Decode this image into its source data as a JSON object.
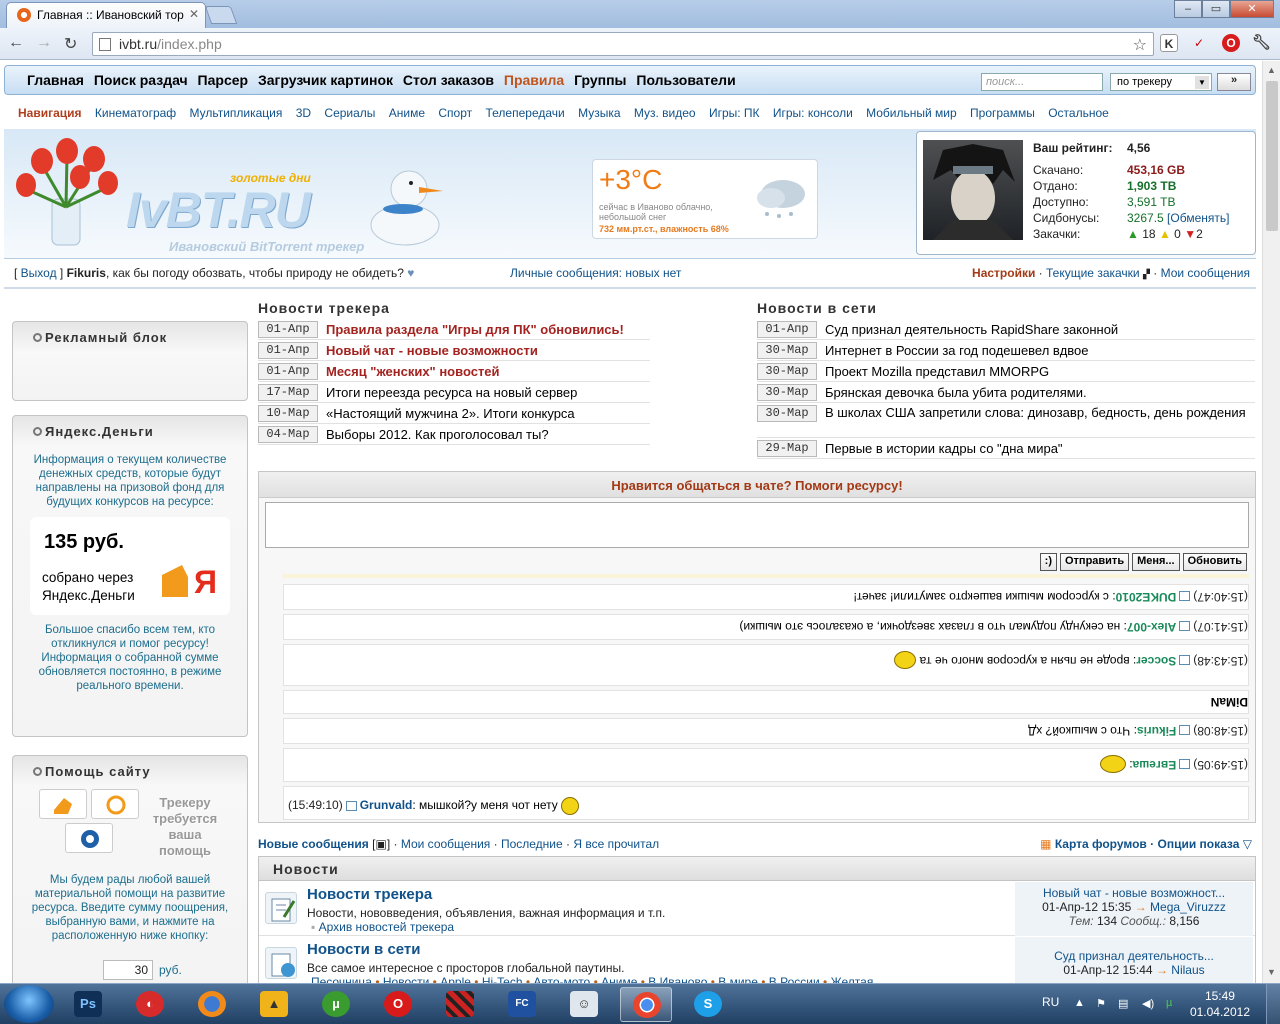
{
  "browser": {
    "tab_title": "Главная :: Ивановский тор",
    "url_host": "ivbt.ru",
    "url_path": "/index.php",
    "window_min": "–",
    "window_max": "▭",
    "window_close": "✕"
  },
  "site": {
    "menu": [
      "Главная",
      "Поиск раздач",
      "Парсер",
      "Загрузчик картинок",
      "Стол заказов",
      "Правила",
      "Группы",
      "Пользователи"
    ],
    "search_placeholder": "поиск...",
    "search_scope": "по трекеру",
    "search_go": "»",
    "categories": [
      "Навигация",
      "Кинематограф",
      "Мультипликация",
      "3D",
      "Сериалы",
      "Аниме",
      "Спорт",
      "Телепередачи",
      "Музыка",
      "Муз. видео",
      "Игры: ПК",
      "Игры: консоли",
      "Мобильный мир",
      "Программы",
      "Остальное"
    ],
    "logo_text": "IvBT.RU",
    "logo_tagline": "золотые дни",
    "logo_subtitle": "Ивановский BitTorrent трекер"
  },
  "weather": {
    "temp": "+3°C",
    "desc": "сейчас в Иваново облачно, небольшой снег",
    "pressure": "732 мм.рт.ст., влажность 68%"
  },
  "user": {
    "rating_label": "Ваш рейтинг:",
    "rating": "4,56",
    "downloaded_label": "Скачано:",
    "downloaded": "453,16 GB",
    "uploaded_label": "Отдано:",
    "uploaded": "1,903 TB",
    "available_label": "Доступно:",
    "available": "3,591 TB",
    "bonus_label": "Сидбонусы:",
    "bonus": "3267.5",
    "bonus_exchange": "[Обменять]",
    "torrents_label": "Закачки:",
    "seeding": "18",
    "leeching": "0",
    "stopped": "2",
    "logout": "Выход",
    "username": "Fikuris",
    "greeting": ", как бы погоду обозвать, чтобы природу не обидеть?",
    "pm_status": "Личные сообщения: новых нет",
    "settings": "Настройки",
    "current_downloads": "Текущие закачки",
    "my_messages": "Мои сообщения"
  },
  "sidebar": {
    "ad_title": "Рекламный блок",
    "yandex_title": "Яндекс.Деньги",
    "yandex_text": "Информация о текущем количестве денежных средств, которые будут направлены на призовой фонд для будущих конкурсов на ресурсе:",
    "yandex_sum": "135 руб.",
    "yandex_via": "собрано через Яндекс.Деньги",
    "yandex_thanks": "Большое спасибо всем тем, кто откликнулся и помог ресурсу! Информация о собранной сумме обновляется постоянно, в режиме реального времени.",
    "help_title": "Помощь сайту",
    "help_banner": "Трекеру требуется ваша помощь",
    "help_text": "Мы будем рады любой вашей материальной помощи на развитие ресурса. Введите сумму поощрения, выбранную вами, и нажмите на расположенную ниже кнопку:",
    "help_amount": "30",
    "help_currency": "руб."
  },
  "tracker_news": {
    "title": "Новости трекера",
    "items": [
      {
        "date": "01-Апр",
        "text": "Правила раздела \"Игры для ПК\" обновились!",
        "hot": true
      },
      {
        "date": "01-Апр",
        "text": "Новый чат - новые возможности",
        "hot": true
      },
      {
        "date": "01-Апр",
        "text": "Месяц \"женских\" новостей",
        "hot": true
      },
      {
        "date": "17-Мар",
        "text": "Итоги переезда ресурса на новый сервер",
        "hot": false
      },
      {
        "date": "10-Мар",
        "text": "«Настоящий мужчина 2». Итоги конкурса",
        "hot": false
      },
      {
        "date": "04-Мар",
        "text": "Выборы 2012. Как проголосовал ты?",
        "hot": false
      }
    ]
  },
  "web_news": {
    "title": "Новости в сети",
    "items": [
      {
        "date": "01-Апр",
        "text": "Суд признал деятельность RapidShare законной"
      },
      {
        "date": "30-Мар",
        "text": "Интернет в России за год подешевел вдвое"
      },
      {
        "date": "30-Мар",
        "text": "Проект Mozilla представил MMORPG"
      },
      {
        "date": "30-Мар",
        "text": "Брянская девочка была убита родителями."
      },
      {
        "date": "30-Мар",
        "text": "В школах США запретили слова: динозавр, бедность, день рождения"
      },
      {
        "date": "29-Мар",
        "text": "Первые в истории кадры со \"дна мира\""
      }
    ]
  },
  "chat": {
    "header": "Нравится общаться в чате? Помоги ресурсу!",
    "btn_smile": ":)",
    "btn_send": "Отправить",
    "btn_menu": "Меня...",
    "btn_refresh": "Обновить",
    "messages": [
      {
        "time": "(15:40:47)",
        "nick": "DUKE2010",
        "text": ": с курсором мышки вашекрто замутили! зачет!",
        "flipped": true
      },
      {
        "time": "(15:41:07)",
        "nick": "Alex-007",
        "text": ": на секунду подумал что в глазах звездочки, а оказалось это мышки)",
        "flipped": true
      },
      {
        "time": "(15:43:48)",
        "nick": "Soccer",
        "text": ": вроде не пьян а курсоров много че та",
        "flipped": true
      },
      {
        "time": "",
        "nick": "DiMaN",
        "text": "",
        "flipped": true
      },
      {
        "time": "(15:48:08)",
        "nick": "Fikuris",
        "text": ": Что с мышкой? хД",
        "flipped": true
      },
      {
        "time": "(15:49:05)",
        "nick": "Евгеша",
        "text": ":",
        "flipped": true
      },
      {
        "time": "(15:49:10)",
        "nick": "Grunvald",
        "text": ": мышкой?у меня чот нету",
        "flipped": false
      }
    ]
  },
  "forum": {
    "new_posts": "Новые сообщения",
    "my_posts": "Мои сообщения",
    "latest": "Последние",
    "mark_read": "Я все прочитал",
    "forum_map": "Карта форумов",
    "view_options": "Опции показа",
    "section": "Новости",
    "rows": [
      {
        "title": "Новости трекера",
        "desc": "Новости, нововведения, объявления, важная информация и т.п.",
        "sub": "Архив новостей трекера",
        "last_title": "Новый чат - новые возможност...",
        "last_date": "01-Апр-12 15:35",
        "last_user": "Mega_Viruzzz",
        "topics_label": "Тем:",
        "topics": "134",
        "posts_label": "Сообщ.:",
        "posts": "8,156"
      },
      {
        "title": "Новости в сети",
        "desc": "Все самое интересное с просторов глобальной паутины.",
        "subs": [
          "Песочница",
          "Новости",
          "Apple",
          "Hi-Tech",
          "Авто-мото",
          "Аниме",
          "В Иваново",
          "В мире",
          "В России",
          "Желтая"
        ],
        "last_title": "Суд признал деятельность...",
        "last_date": "01-Апр-12 15:44",
        "last_user": "Nilaus"
      }
    ]
  },
  "taskbar": {
    "lang": "RU",
    "time": "15:49",
    "date": "01.04.2012"
  }
}
